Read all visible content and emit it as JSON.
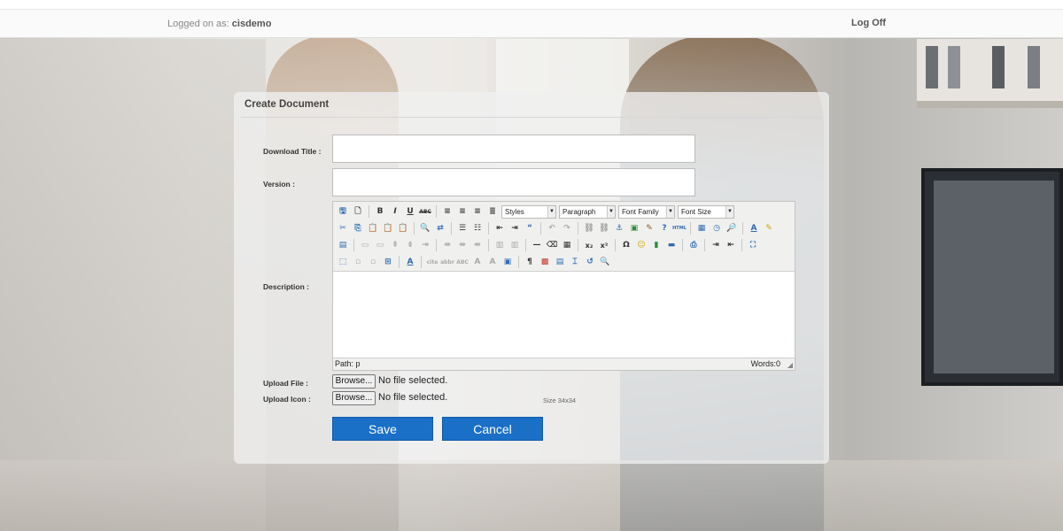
{
  "header": {
    "logged_prefix": "Logged on as:",
    "username": "cisdemo",
    "logoff_label": "Log Off"
  },
  "panel": {
    "title": "Create Document"
  },
  "form": {
    "download_title_label": "Download Title :",
    "download_title_value": "",
    "version_label": "Version :",
    "version_value": "",
    "description_label": "Description :",
    "upload_file_label": "Upload File :",
    "upload_icon_label": "Upload Icon :",
    "browse_label": "Browse...",
    "no_file_text": "No file selected.",
    "size_hint": "Size 34x34"
  },
  "editor": {
    "styles_select": "Styles",
    "paragraph_select": "Paragraph",
    "font_family_select": "Font Family",
    "font_size_select": "Font Size",
    "path_text": "Path: p",
    "words_text": "Words:0"
  },
  "buttons": {
    "save_label": "Save",
    "cancel_label": "Cancel"
  },
  "colors": {
    "primary_button": "#1a6fc6"
  }
}
